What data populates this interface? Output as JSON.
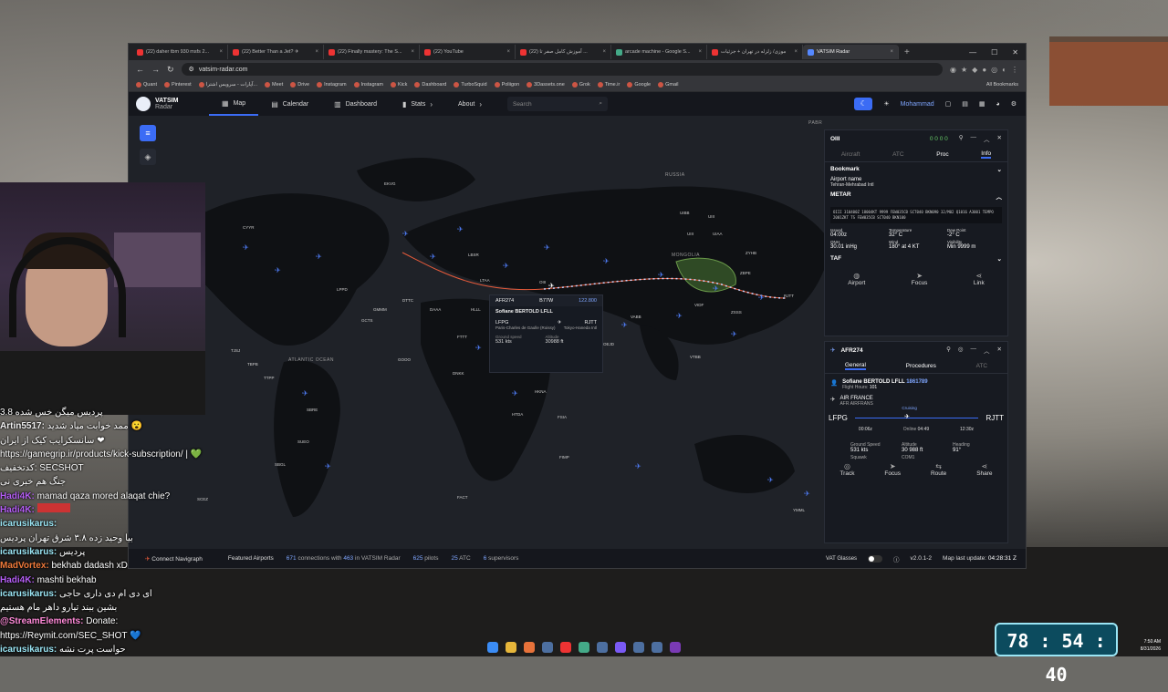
{
  "browser": {
    "tabs": [
      {
        "label": "(22) daher tbm 930 msfs 2..."
      },
      {
        "label": "(22) Better Than a Jet? ✈"
      },
      {
        "label": "(22) Finally mastery: The S..."
      },
      {
        "label": "(22) YouTube"
      },
      {
        "label": "(22) آموزش کامل صفر تا ..."
      },
      {
        "label": "arcade machine - Google S..."
      },
      {
        "label": "موزی/ زلزله در تهران + جزئیات"
      },
      {
        "label": "VATSIM Radar"
      }
    ],
    "url": "vatsim-radar.com",
    "bookmarks": [
      "Quant",
      "Pinterest",
      "آپارات - سرویس اشترا...",
      "Meet",
      "Drive",
      "Instagram",
      "Instagram",
      "Kick",
      "Dashboard",
      "TurboSquid",
      "Poliigon",
      "3Dassets.one",
      "Grok",
      "Time.ir",
      "Google",
      "Gmail"
    ],
    "all_bookmarks": "All Bookmarks"
  },
  "app": {
    "logo_line1": "VATSIM",
    "logo_line2": "Radar",
    "nav": [
      "Map",
      "Calendar",
      "Dashboard",
      "Stats",
      "About"
    ],
    "search_placeholder": "Search",
    "user": "Mohammad"
  },
  "map_labels": {
    "russia": "RUSSIA",
    "mongolia": "MONGOLIA",
    "atlantic": "ATLANTIC OCEAN",
    "fir_labels": [
      "UIBB",
      "UIII",
      "UIAA",
      "UIII",
      "EKVG",
      "CYYR",
      "LPPD",
      "GCTS",
      "DAAA",
      "HECC",
      "HLLL",
      "OEJD",
      "OIII",
      "VIDF",
      "ZBPE",
      "RJTT",
      "VABB",
      "ZSSS",
      "VTBB",
      "LTAA",
      "ZYHB",
      "FIMP",
      "FACT",
      "YMML",
      "NZCH",
      "SBRE",
      "SCEZ",
      "SBGL",
      "FSIA",
      "HKNA",
      "HTDA",
      "GOOO",
      "DRRR",
      "FTTT",
      "DNKK",
      "TJSJ",
      "TBPB",
      "TTPP",
      "SUEO",
      "GMMM",
      "DTTC",
      "LBSR"
    ],
    "pabr": "PABR"
  },
  "flight_popup": {
    "callsign": "AFR274",
    "aircraft": "B77W",
    "squawk": "122.800",
    "pilot": "Sofiane BERTOLD LFLL",
    "dep_icao": "LFPG",
    "dep_name": "Paris-Charles de Gaulle (Roissy)",
    "arr_icao": "RJTT",
    "arr_name": "Tokyo-Haneda Intl",
    "gs_label": "Ground speed",
    "gs_value": "531 kts",
    "alt_label": "Altitude",
    "alt_value": "30988 ft"
  },
  "airport_panel": {
    "icao": "OIII",
    "counts": "0 0 0 0",
    "tabs": [
      "Aircraft",
      "ATC",
      "Proc",
      "Info"
    ],
    "bookmark": "Bookmark",
    "airport_name_label": "Airport name",
    "airport_name": "Tehran-Mehrabad Intl",
    "metar_label": "METAR",
    "metar_text": "OIII 310400Z 18004KT 9999 FEW035CB SCT040 BKN090 32/M02 Q1016 A3001 TEMPO 2001ZKT TS FEW035CB SCT040 BKN100",
    "wx": [
      {
        "label": "Issued",
        "value": "04:00z"
      },
      {
        "label": "Temperature",
        "value": "32° C"
      },
      {
        "label": "Dew Point",
        "value": "-2° C"
      },
      {
        "label": "QNH",
        "value": "30.01 inHg"
      },
      {
        "label": "Wind",
        "value": "180° at 4 KT"
      },
      {
        "label": "Visibility",
        "value": "Min 9999 m"
      }
    ],
    "taf_label": "TAF",
    "actions": [
      "Airport",
      "Focus",
      "Link"
    ]
  },
  "flight_panel": {
    "callsign": "AFR274",
    "tabs": [
      "General",
      "Procedures",
      "ATC"
    ],
    "pilot": "Sofiane BERTOLD LFLL",
    "pilot_id": "1861789",
    "flight_hours_label": "Flight Hours:",
    "flight_hours": "101",
    "airline": "AIR FRANCE",
    "airline_codes": "AFR  AIRFRANS",
    "dep": "LFPG",
    "arr": "RJTT",
    "phase": "Cruising",
    "dep_time": "00:06z",
    "online_label": "Online",
    "online": "04:49",
    "eta": "12:30z",
    "gs_label": "Ground Speed",
    "gs": "531 kts",
    "alt_label": "Altitude",
    "alt": "30 988 ft",
    "hdg_label": "Heading",
    "hdg": "91°",
    "squawk_label": "Squawk",
    "squawk": "COM1",
    "actions": [
      "Track",
      "Focus",
      "Route",
      "Share"
    ]
  },
  "bottom_bar": {
    "connect": "Connect Navigraph",
    "featured": "Featured Airports",
    "connections": "671",
    "connections_text": "connections with",
    "radar_users": "463",
    "radar_text": "in VATSIM Radar",
    "pilots": "625",
    "pilots_text": "pilots",
    "atc": "25",
    "atc_text": "ATC",
    "supervisors": "6",
    "supervisors_text": "supervisors",
    "vat_glasses": "VAT Glasses",
    "version": "v2.0.1-2",
    "last_update_label": "Map last update:",
    "last_update": "04:28:31 Z"
  },
  "chat": [
    {
      "user": "",
      "text": "پردیس میگن خس شده 3.8"
    },
    {
      "user": "Artin5517:",
      "text": "ممد خوابت میاد شدید 😮"
    },
    {
      "user": "",
      "text": "سانسکرایب کیک از ایران ❤"
    },
    {
      "user": "",
      "text": "https://gamegrip.ir/products/kick-subscription/ | 💚"
    },
    {
      "user": "",
      "text": "کدتخفیف: SECSHOT"
    },
    {
      "user": "",
      "text": "جنگ هم خبری نی"
    },
    {
      "user": "Hadi4K:",
      "text": "mamad qaza mored alaqat chie?"
    },
    {
      "user": "Hadi4K:",
      "text": ""
    },
    {
      "user": "icarusikarus:",
      "text": ""
    },
    {
      "user": "",
      "text": "بیا وحید زده ۳.۸ شرق تهران پردیس"
    },
    {
      "user": "icarusikarus:",
      "text": "پردیس"
    },
    {
      "user": "MadVortex:",
      "text": "bekhab dadash xD"
    },
    {
      "user": "Hadi4K:",
      "text": "mashti bekhab"
    },
    {
      "user": "icarusikarus:",
      "text": "ای دی ام دی داری حاجی"
    },
    {
      "user": "",
      "text": "بشین ببند تیارو داهر مام هستیم"
    },
    {
      "user": "@StreamElements:",
      "text": "Donate:"
    },
    {
      "user": "",
      "text": "https://Reymit.com/SEC_SHOT 💙"
    },
    {
      "user": "icarusikarus:",
      "text": "حواست پرت نشه"
    }
  ],
  "timer": "78 : 54 : 40",
  "clock": {
    "time": "7:50 AM",
    "date": "8/31/2026"
  },
  "colors": {
    "accent": "#3b6cf5",
    "route": "#e55a3a",
    "plane": "#4f7df7"
  }
}
